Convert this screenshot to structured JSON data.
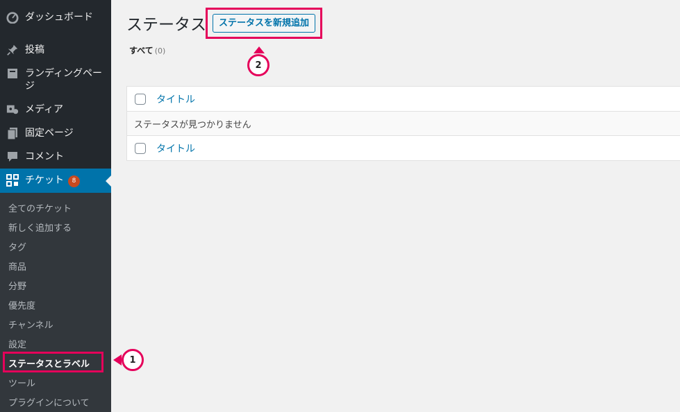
{
  "sidebar": {
    "menu": [
      {
        "label": "ダッシュボード",
        "icon": "dashboard-icon"
      },
      {
        "label": "投稿",
        "icon": "pin-icon"
      },
      {
        "label": "ランディングページ",
        "icon": "landing-page-icon"
      },
      {
        "label": "メディア",
        "icon": "media-icon"
      },
      {
        "label": "固定ページ",
        "icon": "page-icon"
      },
      {
        "label": "コメント",
        "icon": "comment-icon"
      },
      {
        "label": "チケット",
        "icon": "ticket-grid-icon",
        "badge": "8"
      }
    ],
    "submenu": [
      {
        "label": "全てのチケット"
      },
      {
        "label": "新しく追加する"
      },
      {
        "label": "タグ"
      },
      {
        "label": "商品"
      },
      {
        "label": "分野"
      },
      {
        "label": "優先度"
      },
      {
        "label": "チャンネル"
      },
      {
        "label": "設定"
      },
      {
        "label": "ステータスとラベル"
      },
      {
        "label": "ツール"
      },
      {
        "label": "プラグインについて"
      }
    ]
  },
  "main": {
    "page_title": "ステータス",
    "add_new_label": "ステータスを新規追加",
    "filter": {
      "label": "すべて",
      "count": "(0)"
    },
    "table": {
      "header_title": "タイトル",
      "empty_message": "ステータスが見つかりません",
      "footer_title": "タイトル"
    }
  },
  "annotations": {
    "step1": "1",
    "step2": "2"
  },
  "colors": {
    "accent": "#e5005a",
    "admin_blue": "#0073aa",
    "sidebar_bg": "#23282d"
  }
}
